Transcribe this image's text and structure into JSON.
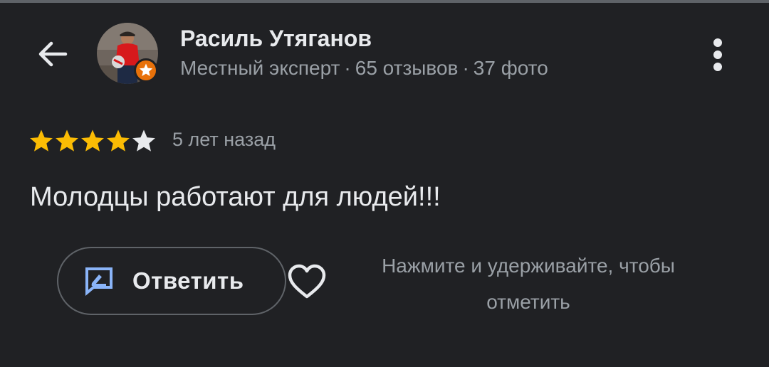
{
  "header": {
    "back_icon": "arrow-left-icon",
    "author_name": "Расиль Утяганов",
    "author_level": "Местный эксперт",
    "reviews_count": "65 отзывов",
    "photos_count": "37 фото",
    "meta_separator": "·",
    "badge_icon": "local-guide-star-icon",
    "more_icon": "more-vertical-icon"
  },
  "review": {
    "rating": 4,
    "rating_max": 5,
    "time_ago": "5 лет назад",
    "text": "Молодцы работают для людей!!!"
  },
  "actions": {
    "reply_label": "Ответить",
    "reply_icon": "reply-edit-icon",
    "like_icon": "heart-outline-icon",
    "like_hint": "Нажмите и удерживайте, чтобы отметить"
  },
  "colors": {
    "background": "#202124",
    "primary_text": "#e8eaed",
    "secondary_text": "#9aa0a6",
    "star_filled": "#fbbc04",
    "star_empty": "#e8eaed",
    "badge": "#e8710a",
    "reply_icon": "#8ab4f8"
  }
}
